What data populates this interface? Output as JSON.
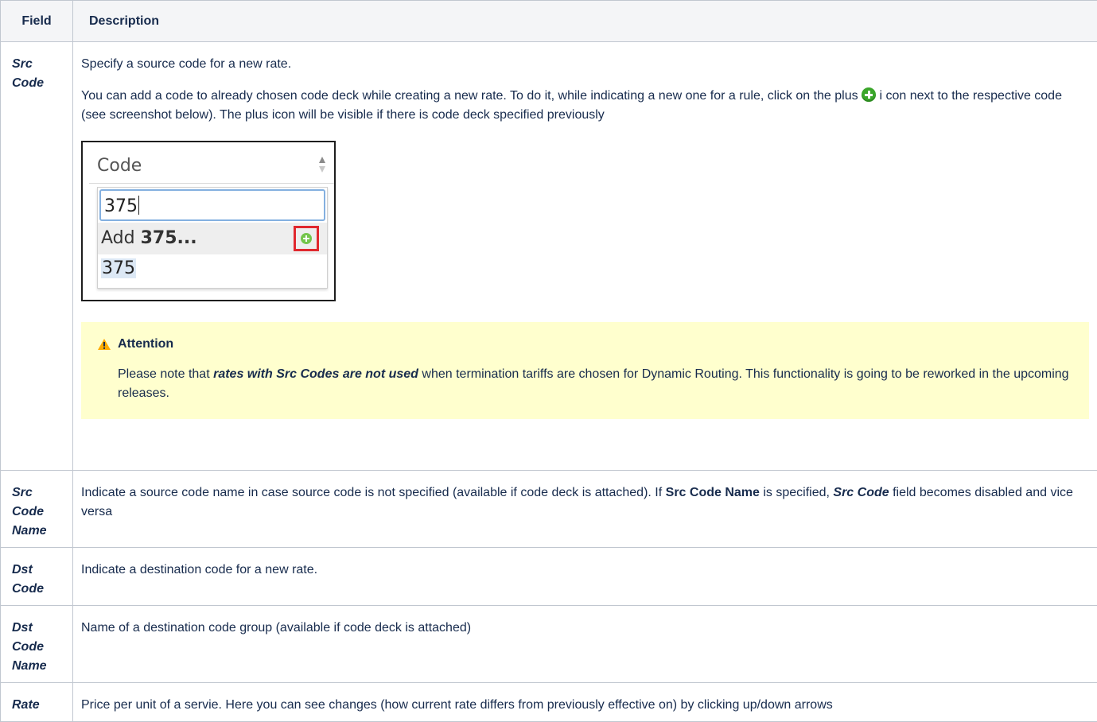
{
  "table": {
    "headers": {
      "field": "Field",
      "description": "Description"
    },
    "rows": [
      {
        "field": "Src Code",
        "p1": "Specify a source code for a new rate.",
        "p2a": "You can add a code to already chosen code deck while creating a new rate. To do it, while indicating a new one for a rule, click on the plus ",
        "p2b": " i con next to the respective code (see screenshot below). The plus icon will be visible if there is code deck specified previously"
      },
      {
        "field": "Src Code Name",
        "p_a": "Indicate a source code name in case source code is not specified (available if code deck is attached). If ",
        "p_b": "Src Code Name",
        "p_c": " is specified, ",
        "p_d": "Src Code",
        "p_e": " field becomes disabled and vice versa"
      },
      {
        "field": "Dst Code",
        "text": "Indicate a destination code for a new rate."
      },
      {
        "field": "Dst Code Name",
        "text": "Name of a destination code group (available if code deck is attached)"
      },
      {
        "field": "Rate",
        "text": "Price per unit of a servie. Here you can see changes (how current rate differs from previously effective on) by clicking up/down arrows"
      }
    ]
  },
  "screenshot": {
    "header_label": "Code",
    "search_value": "375",
    "add_prefix": "Add ",
    "add_code": "375...",
    "result": "375"
  },
  "attention": {
    "title": "Attention",
    "text_a": "Please note that ",
    "text_b": "rates with Src Codes are not used",
    "text_c": " when termination tariffs are chosen for Dynamic Routing. This functionality is going to be reworked in the upcoming releases."
  },
  "colors": {
    "header_bg": "#f4f5f7",
    "border": "#c1c7d0",
    "attention_bg": "#ffffce",
    "plus_green": "#3aa62a",
    "highlight_red": "#e0282e",
    "warning_yellow": "#ffab00"
  },
  "icons": [
    "plus-circle-icon",
    "sort-arrows-icon",
    "warning-icon"
  ]
}
